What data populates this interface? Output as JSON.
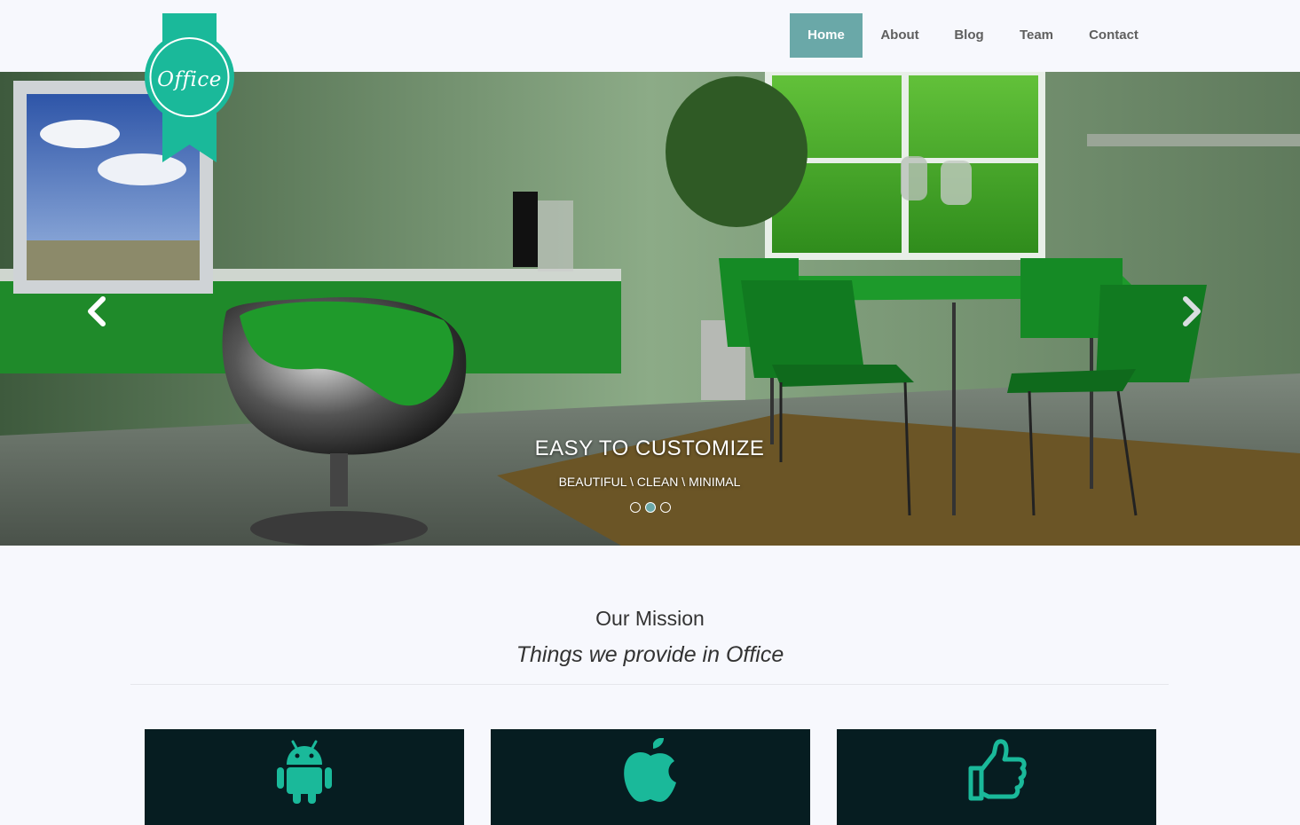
{
  "brand": {
    "logo_text": "Office",
    "accent_color": "#1ab99a",
    "nav_active_color": "#6aa8a8"
  },
  "nav": {
    "items": [
      {
        "label": "Home",
        "active": true
      },
      {
        "label": "About",
        "active": false
      },
      {
        "label": "Blog",
        "active": false
      },
      {
        "label": "Team",
        "active": false
      },
      {
        "label": "Contact",
        "active": false
      }
    ]
  },
  "hero": {
    "title": "EASY TO CUSTOMIZE",
    "subtitle": "BEAUTIFUL \\ CLEAN \\ MINIMAL",
    "slide_count": 3,
    "active_slide": 2,
    "prev_icon": "chevron-left-icon",
    "next_icon": "chevron-right-icon"
  },
  "mission": {
    "title": "Our Mission",
    "subtitle": "Things we provide in Office"
  },
  "cards": [
    {
      "icon": "android-icon"
    },
    {
      "icon": "apple-icon"
    },
    {
      "icon": "thumbs-up-icon"
    }
  ]
}
